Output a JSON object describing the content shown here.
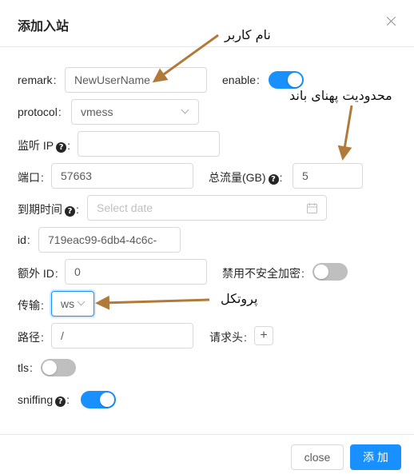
{
  "dialog": {
    "title": "添加入站",
    "close_icon": "close-icon"
  },
  "form": {
    "remark": {
      "label": "remark",
      "value": "NewUserName"
    },
    "enable": {
      "label": "enable",
      "on": true
    },
    "protocol": {
      "label": "protocol",
      "value": "vmess"
    },
    "listen_ip": {
      "label": "监听 IP",
      "value": ""
    },
    "port": {
      "label": "端口",
      "value": "57663"
    },
    "total_traffic": {
      "label": "总流量(GB)",
      "value": "5"
    },
    "expiry": {
      "label": "到期时间",
      "placeholder": "Select date"
    },
    "id": {
      "label": "id",
      "value": "719eac99-6db4-4c6c-"
    },
    "alter_id": {
      "label": "额外 ID",
      "value": "0"
    },
    "disable_insecure": {
      "label": "禁用不安全加密",
      "on": false
    },
    "transport": {
      "label": "传输",
      "value": "ws"
    },
    "path": {
      "label": "路径",
      "value": "/"
    },
    "request_headers": {
      "label": "请求头",
      "add_label": "+"
    },
    "tls": {
      "label": "tls",
      "on": false
    },
    "sniffing": {
      "label": "sniffing",
      "on": true
    },
    "colon": ":",
    "help_icon": "?"
  },
  "footer": {
    "close_label": "close",
    "add_label": "添 加"
  },
  "annotations": {
    "username": "نام کاربر",
    "bandwidth": "محدودیت پهنای باند",
    "protocol": "پروتکل",
    "arrow_color": "#b07a3a"
  },
  "colors": {
    "primary": "#1890ff",
    "switch_off": "#bfbfbf",
    "border": "#d9d9d9"
  }
}
